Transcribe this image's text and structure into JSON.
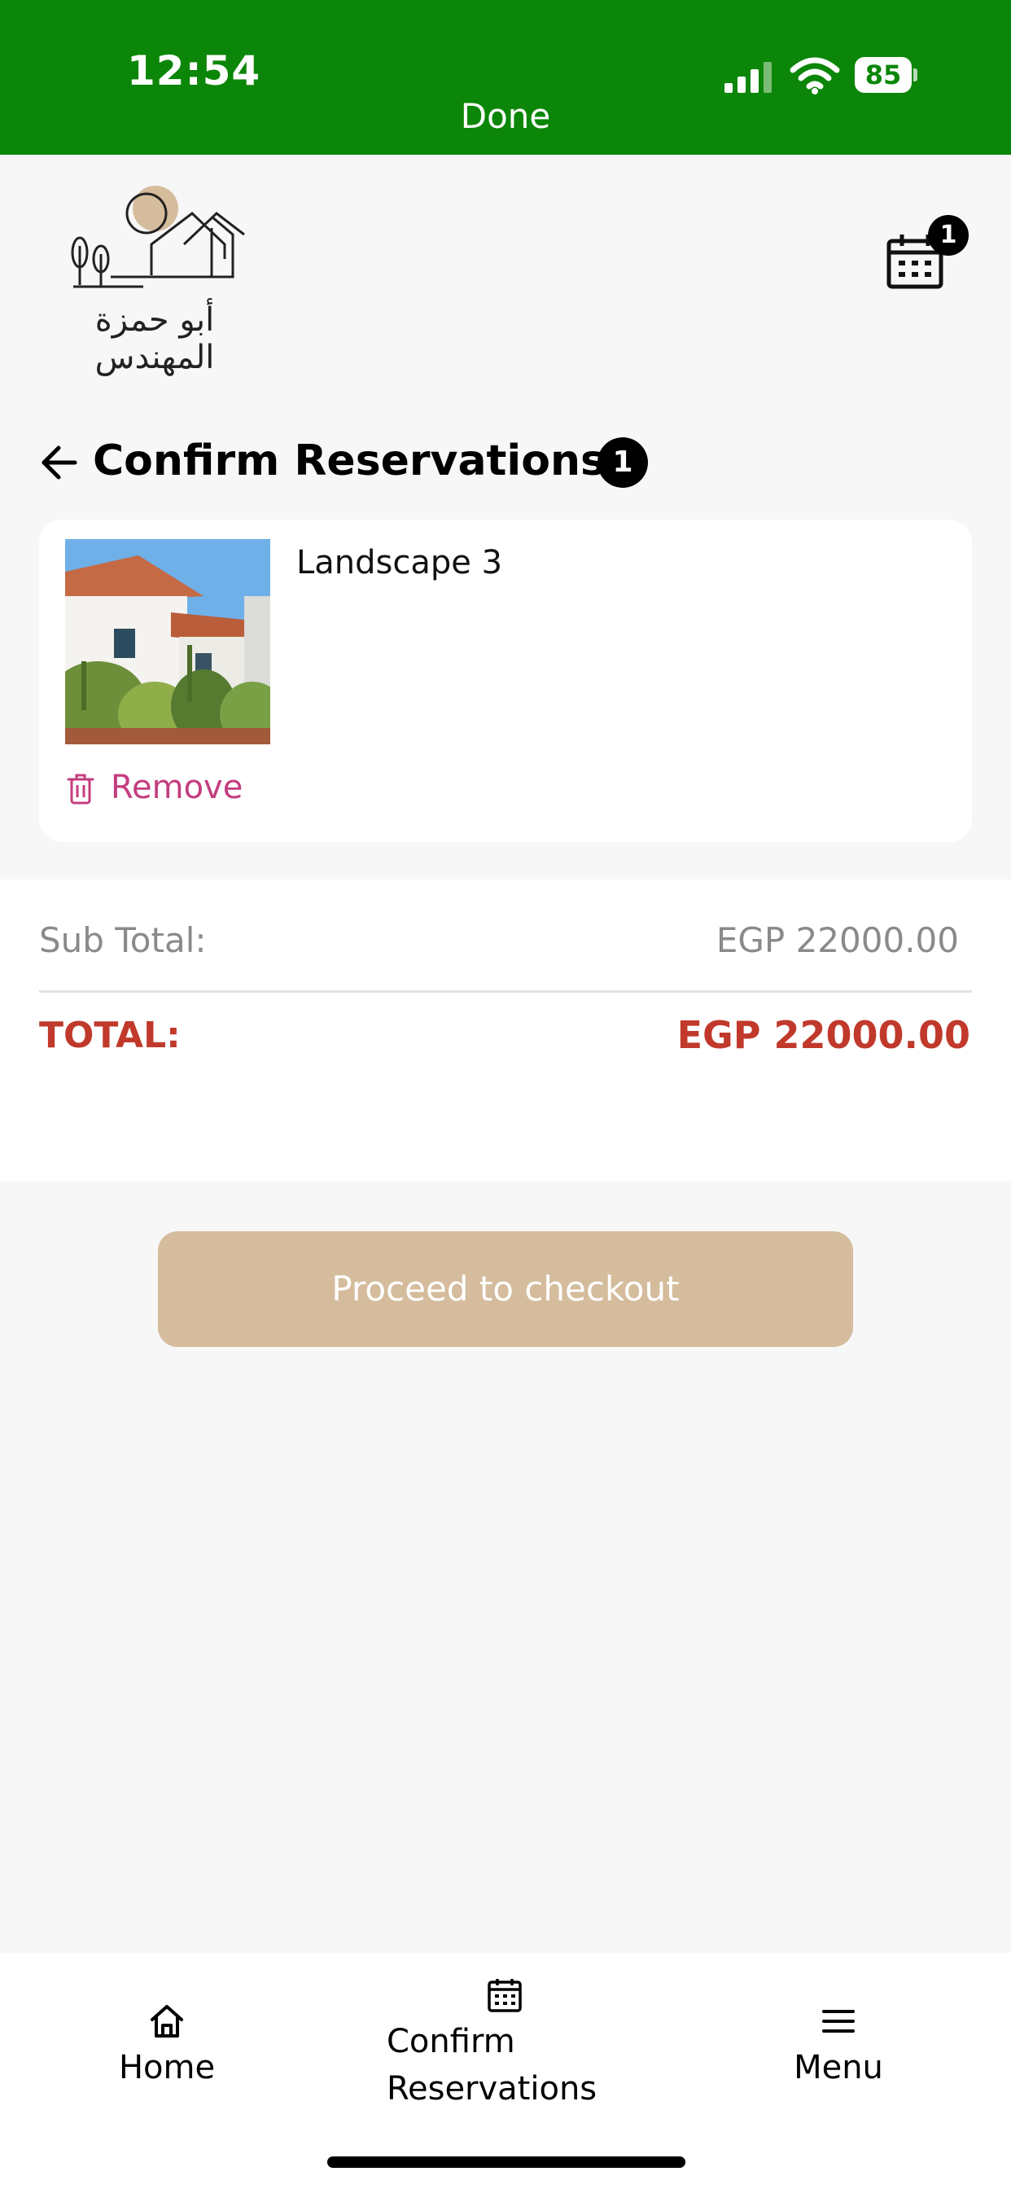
{
  "status_bar": {
    "time": "12:54",
    "done_label": "Done",
    "battery": "85",
    "background_color": "#0b8608"
  },
  "header": {
    "logo_text": "أبو حمزة المهندس",
    "logo_icon": "house-sun-logo",
    "cart_icon": "calendar-icon",
    "cart_count": "1"
  },
  "page": {
    "back_icon": "arrow-left-icon",
    "title": "Confirm Reservations:",
    "count": "1"
  },
  "reservations": [
    {
      "name": "Landscape 3",
      "image": "house-garden-photo",
      "remove_label": "Remove",
      "remove_icon": "trash-icon"
    }
  ],
  "totals": {
    "subtotal_label": "Sub Total:",
    "subtotal_value": "EGP 22000.00",
    "total_label": "TOTAL:",
    "total_value": "EGP 22000.00",
    "total_color": "#c0392b"
  },
  "checkout": {
    "label": "Proceed to checkout",
    "color": "#d4bc9c"
  },
  "bottom_nav": {
    "items": [
      {
        "label": "Home",
        "icon": "home-icon"
      },
      {
        "label_line1": "Confirm",
        "label_line2": "Reservations",
        "icon": "calendar-icon"
      },
      {
        "label": "Menu",
        "icon": "menu-icon"
      }
    ]
  }
}
